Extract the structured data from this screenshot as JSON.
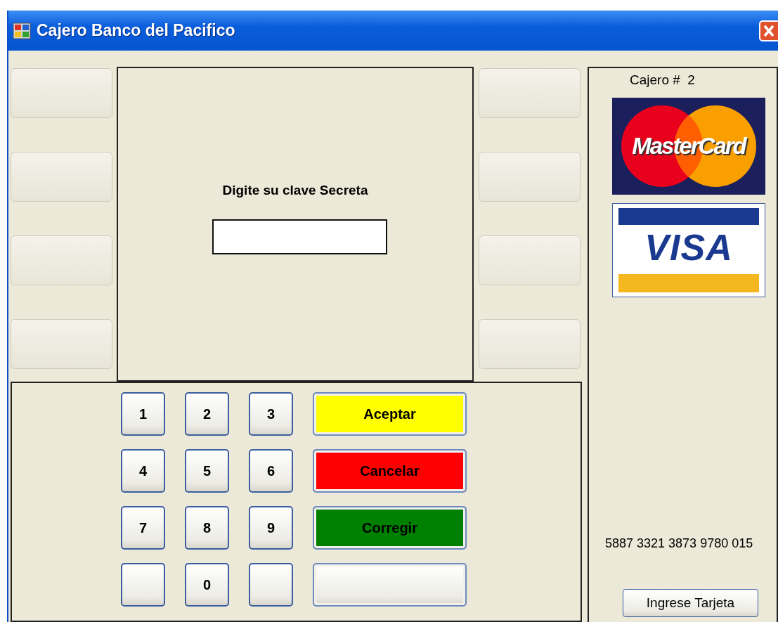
{
  "window": {
    "title": "Cajero Banco del Pacifico"
  },
  "screen": {
    "prompt": "Digite su clave Secreta"
  },
  "keypad": {
    "keys": [
      {
        "kind": "digit",
        "label": "1"
      },
      {
        "kind": "digit",
        "label": "2"
      },
      {
        "kind": "digit",
        "label": "3"
      },
      {
        "kind": "digit",
        "label": "4"
      },
      {
        "kind": "digit",
        "label": "5"
      },
      {
        "kind": "digit",
        "label": "6"
      },
      {
        "kind": "digit",
        "label": "7"
      },
      {
        "kind": "digit",
        "label": "8"
      },
      {
        "kind": "digit",
        "label": "9"
      },
      {
        "kind": "blank"
      },
      {
        "kind": "digit",
        "label": "0"
      },
      {
        "kind": "blank"
      }
    ],
    "actions": [
      {
        "kind": "action",
        "label": "Aceptar",
        "color": "#ffff00"
      },
      {
        "kind": "action",
        "label": "Cancelar",
        "color": "#ff0000"
      },
      {
        "kind": "action",
        "label": "Corregir",
        "color": "#008000"
      },
      {
        "kind": "blank"
      }
    ]
  },
  "side_panel": {
    "atm_label": "Cajero #  2",
    "card_logos": [
      "MasterCard",
      "VISA"
    ],
    "card_number": "5887 3321 3873 9780 015",
    "insert_button": "Ingrese Tarjeta"
  }
}
